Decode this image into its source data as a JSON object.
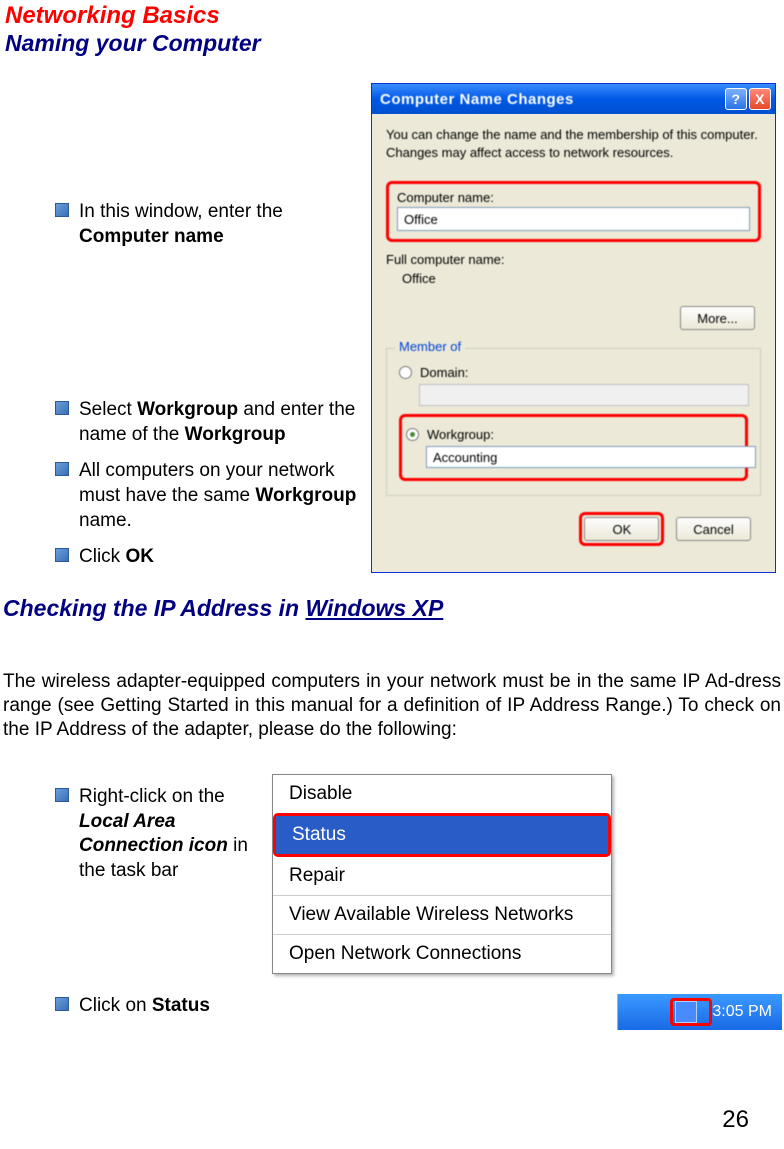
{
  "header": {
    "red": "Networking Basics",
    "navy": "Naming your Computer"
  },
  "bullets_top": {
    "line1": "In this window, enter the",
    "bold1": "Computer name"
  },
  "bullets_mid": {
    "b1_line1": "Select ",
    "b1_bold1": "Workgroup",
    "b1_line2": " and enter the name of the ",
    "b1_bold2": "Workgroup",
    "b2_line1": "All computers on your network must have the same ",
    "b2_bold1": "Workgroup",
    "b2_line2": " name.",
    "b3_line1": "Click ",
    "b3_bold1": "OK"
  },
  "dialog": {
    "title": "Computer Name Changes",
    "desc": "You can change the name and the membership of this computer. Changes may affect access to network resources.",
    "computer_name_label": "Computer name:",
    "computer_name_value": "Office",
    "full_name_label": "Full computer name:",
    "full_name_value": "Office",
    "more_btn": "More...",
    "groupbox_title": "Member of",
    "domain_label": "Domain:",
    "workgroup_label": "Workgroup:",
    "workgroup_value": "Accounting",
    "ok_btn": "OK",
    "cancel_btn": "Cancel"
  },
  "section2": {
    "prefix": "Checking the IP Address in ",
    "underline": "Windows XP"
  },
  "body_para": "The wireless adapter-equipped computers in your network must be in the same IP Ad-dress range (see Getting Started in this manual for a definition of IP Address Range.)  To check on the IP Address of the adapter, please do the following:",
  "bullets_bottom": {
    "b1_line1": "Right-click on the ",
    "b1_boldital1": "Local Area Connection icon",
    "b1_line2": " in the task bar",
    "b2_line1": "Click on ",
    "b2_bold1": "Status"
  },
  "ctxmenu": {
    "disable": "Disable",
    "status": "Status",
    "repair": "Repair",
    "view": "View Available Wireless Networks",
    "open": "Open Network Connections"
  },
  "tray": {
    "time": "3:05 PM"
  },
  "page_num": "26"
}
